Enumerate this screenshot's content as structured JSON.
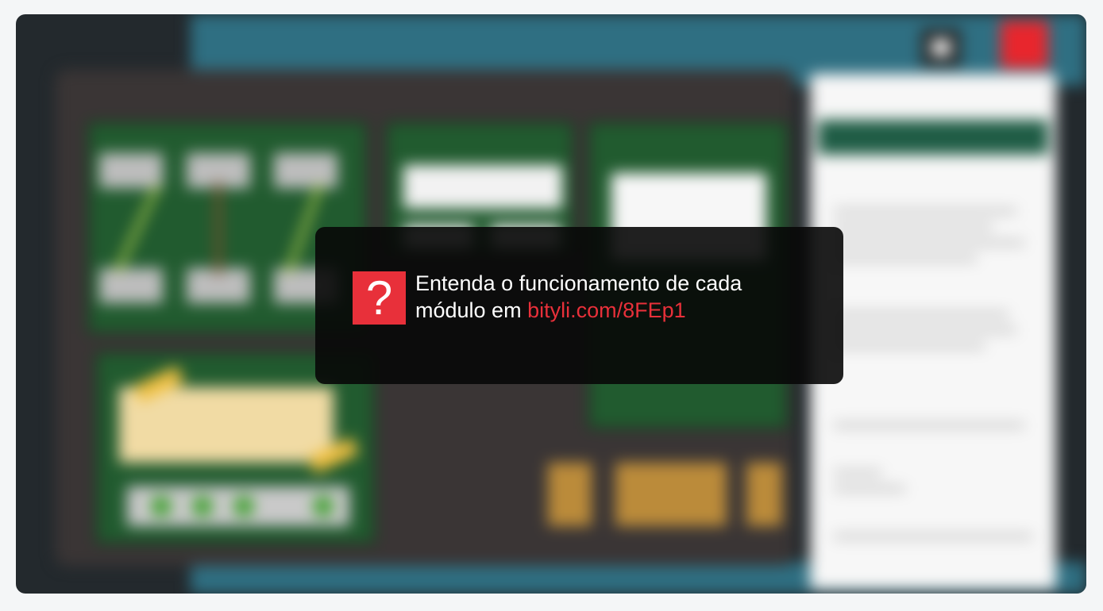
{
  "overlay": {
    "icon": "question-mark-icon",
    "icon_glyph": "?",
    "message_line1": "Entenda o funcionamento de cada",
    "message_line2": "módulo em",
    "link_text": "bityli.com/8FEp1",
    "accent_color": "#e8303a"
  }
}
